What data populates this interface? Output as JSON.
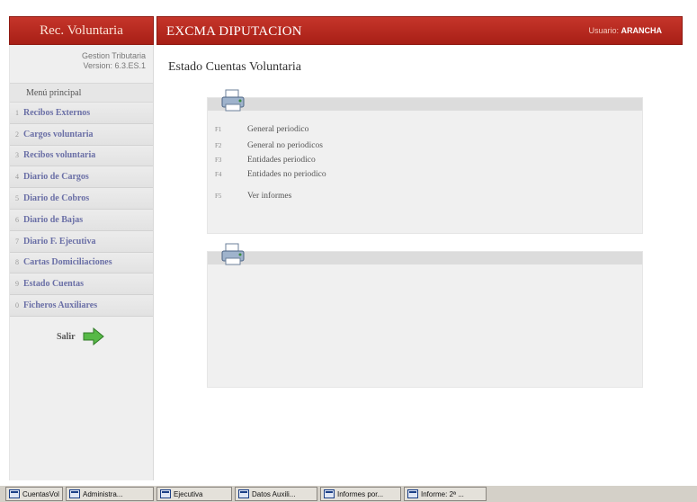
{
  "left_header": {
    "title": "Rec. Voluntaria"
  },
  "top_header": {
    "title": "EXCMA DIPUTACION",
    "user_label": "Usuario:",
    "user_name": "ARANCHA"
  },
  "sidebar": {
    "version_line1": "Gestion Tributaria",
    "version_line2": "Version: 6.3.ES.1",
    "menu_title": "Menú principal",
    "items": [
      {
        "key": "1",
        "label": "Recibos Externos"
      },
      {
        "key": "2",
        "label": "Cargos voluntaria"
      },
      {
        "key": "3",
        "label": "Recibos voluntaria"
      },
      {
        "key": "4",
        "label": "Diario de Cargos"
      },
      {
        "key": "5",
        "label": "Diario de Cobros"
      },
      {
        "key": "6",
        "label": "Diario de Bajas"
      },
      {
        "key": "7",
        "label": "Diario F. Ejecutiva"
      },
      {
        "key": "8",
        "label": "Cartas Domiciliaciones"
      },
      {
        "key": "9",
        "label": "Estado Cuentas"
      },
      {
        "key": "0",
        "label": "Ficheros Auxiliares"
      }
    ],
    "exit_label": "Salir"
  },
  "main": {
    "page_title": "Estado Cuentas Voluntaria",
    "options": [
      {
        "key": "F1",
        "label": "General periodico"
      },
      {
        "key": "F2",
        "label": "General no periodicos"
      },
      {
        "key": "F3",
        "label": "Entidades periodico"
      },
      {
        "key": "F4",
        "label": "Entidades no periodico"
      },
      {
        "key": "F5",
        "label": "Ver informes"
      }
    ]
  },
  "taskbar": {
    "items": [
      "CuentasVol",
      "Administra...",
      "Ejecutiva",
      "Datos Auxili...",
      "Informes por...",
      "Informe: 2ª ..."
    ]
  },
  "colors": {
    "header_red": "#b8281e",
    "menu_text": "#6a6fa6",
    "panel_bg": "#f0f0f0"
  }
}
